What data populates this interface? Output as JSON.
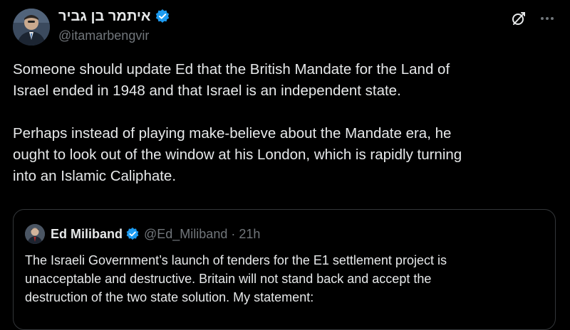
{
  "colors": {
    "background": "#000000",
    "text_primary": "#e7e9ea",
    "text_secondary": "#71767b",
    "verified_badge": "#1d9bf0",
    "border": "#333639"
  },
  "tweet": {
    "author": {
      "display_name": "איתמר בן גביר",
      "handle": "@itamarbengvir",
      "verified_icon": "verified-badge-icon",
      "avatar_icon": "avatar"
    },
    "actions": {
      "grok_icon": "grok-icon",
      "more_icon": "more-icon"
    },
    "text": {
      "paragraph_1": "Someone should update Ed that the British Mandate for the Land of\nIsrael ended in 1948 and that Israel is an independent state.",
      "paragraph_2": "Perhaps instead of playing make-believe about the Mandate era, he\nought to look out of the window at his London, which is rapidly turning\ninto an Islamic Caliphate."
    },
    "quoted_tweet": {
      "display_name": "Ed Miliband",
      "handle": "@Ed_Miliband",
      "separator": "·",
      "time": "21h",
      "text": "The Israeli Government’s launch of tenders for the E1 settlement project is\nunacceptable and destructive. Britain will not stand back and accept the\ndestruction of the two state solution. My statement:"
    }
  }
}
